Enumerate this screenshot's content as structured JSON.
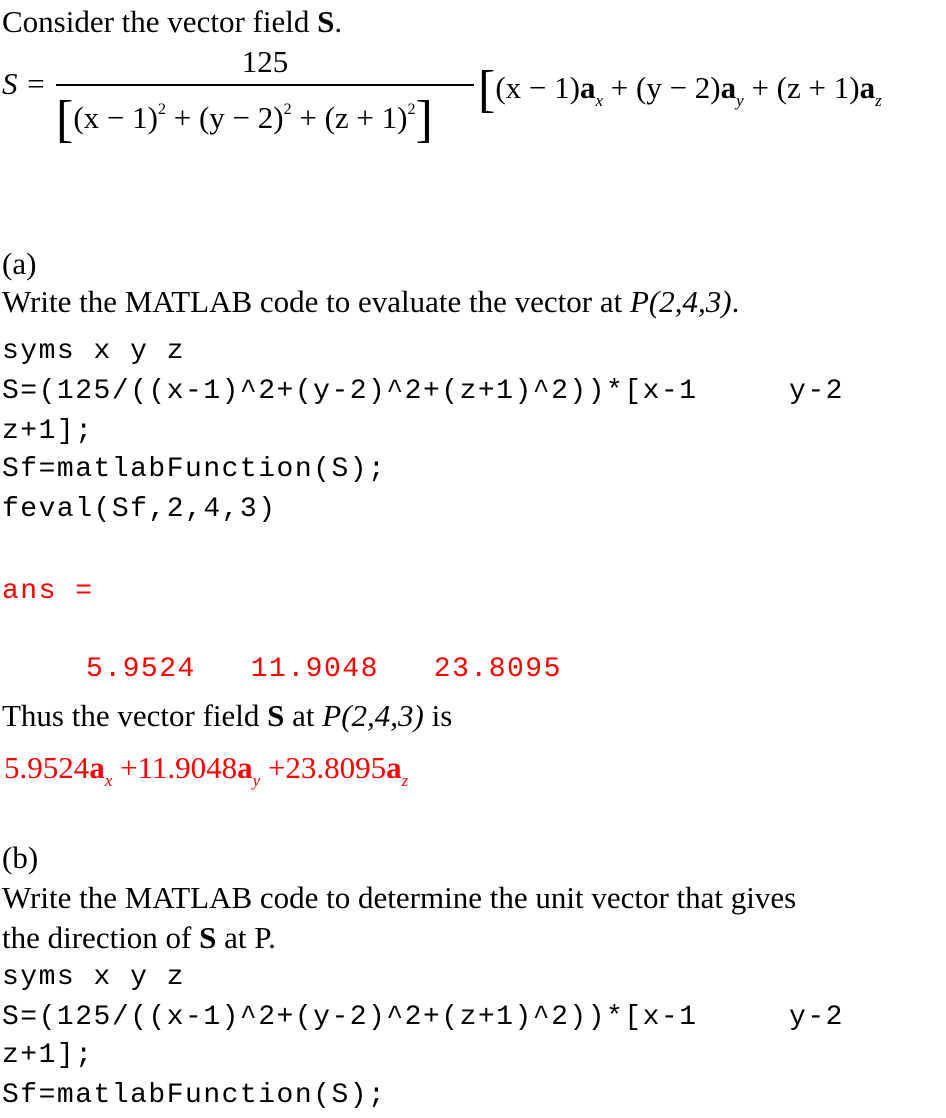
{
  "intro": {
    "text": "Consider the vector field ",
    "bold": "S",
    "end": "."
  },
  "equation": {
    "lhs": "S =",
    "numerator": "125",
    "denominator": [
      "(x − 1)",
      "2",
      " + (y − 2)",
      "2",
      " + (z + 1)",
      "2"
    ],
    "vector_terms": [
      {
        "coef": "(x − 1)",
        "unit": "a",
        "sub": "x"
      },
      {
        "coef": "(y − 2)",
        "unit": "a",
        "sub": "y"
      },
      {
        "coef": "(z + 1)",
        "unit": "a",
        "sub": "z"
      }
    ]
  },
  "part_a": {
    "label": "(a)",
    "prompt": "Write the MATLAB code to evaluate the vector at ",
    "point": "P(2,4,3)",
    "code": [
      "syms x y z",
      "S=(125/((x-1)^2+(y-2)^2+(z+1)^2))*[x-1     y-2",
      "z+1];",
      "Sf=matlabFunction(S);",
      "feval(Sf,2,4,3)"
    ],
    "output_label": "ans =",
    "output_values": [
      "5.9524",
      "11.9048",
      "23.8095"
    ],
    "conclusion_pre": "Thus the vector field ",
    "conclusion_bold": "S",
    "conclusion_mid": " at ",
    "conclusion_point": "P(2,4,3)",
    "conclusion_end": " is",
    "result": [
      {
        "coef": "5.9524",
        "unit": "a",
        "sub": "x"
      },
      {
        "coef": "+11.9048",
        "unit": "a",
        "sub": "y"
      },
      {
        "coef": "+23.8095",
        "unit": "a",
        "sub": "z"
      }
    ]
  },
  "part_b": {
    "label": "(b)",
    "prompt_line1": "Write the MATLAB code to determine the unit vector that gives",
    "prompt_line2_pre": "the direction of ",
    "prompt_line2_bold": "S",
    "prompt_line2_end": " at P.",
    "code": [
      "syms x y z",
      "S=(125/((x-1)^2+(y-2)^2+(z+1)^2))*[x-1     y-2",
      "z+1];",
      "Sf=matlabFunction(S);"
    ]
  },
  "colors": {
    "text": "#000000",
    "output": "#ff0000"
  }
}
